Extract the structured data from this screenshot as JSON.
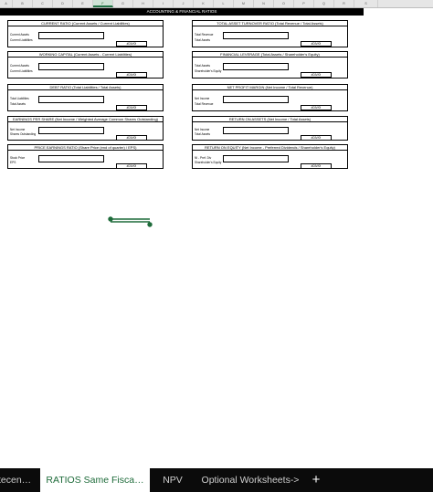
{
  "sheet": {
    "columns": [
      "A",
      "B",
      "C",
      "D",
      "E",
      "F",
      "G",
      "H",
      "I",
      "J",
      "K",
      "L",
      "M",
      "N",
      "O",
      "P",
      "Q",
      "R",
      "S"
    ],
    "selected_column": "F",
    "banner": "ACCOUNTING & FINANCIAL RATIOS"
  },
  "ratios": {
    "current_ratio": {
      "title": "CURRENT RATIO (Current Assets / Current Liabilities)",
      "labels": [
        "Current Assets",
        "Current Liabilities"
      ],
      "result": "#DIV/0!"
    },
    "asset_turnover": {
      "title": "TOTAL ASSET TURNOVER RATIO (Total Revenue / Total Assets)",
      "labels": [
        "Total Revenue",
        "Total Assets"
      ],
      "result": "#DIV/0!"
    },
    "working_capital": {
      "title": "WORKING CAPITAL (Current Assets - Current Liabilities)",
      "labels": [
        "Current Assets",
        "Current Liabilities"
      ],
      "result": "#DIV/0!"
    },
    "financial_leverage": {
      "title": "FINANCIAL LEVERAGE (Total Assets / Shareholder's Equity)",
      "labels": [
        "Total Assets",
        "Shareholder's Equity"
      ],
      "result": "#DIV/0!"
    },
    "debt_ratio": {
      "title": "DEBT RATIO (Total Liabilities / Total Assets)",
      "labels": [
        "Total Liabilities",
        "Total Assets"
      ],
      "result": "#DIV/0!"
    },
    "net_profit_margin": {
      "title": "NET PROFIT MARGIN (Net Income / Total Revenue)",
      "labels": [
        "Net Income",
        "Total Revenue"
      ],
      "result": "#DIV/0!"
    },
    "eps": {
      "title": "EARNINGS PER SHARE (Net Income / Weighted Average Common Shares Outstanding)",
      "labels": [
        "Net Income",
        "Shares Outstanding"
      ],
      "result": "#DIV/0!"
    },
    "roa": {
      "title": "RETURN ON ASSETS (Net Income / Total Assets)",
      "labels": [
        "Net Income",
        "Total Assets"
      ],
      "result": "#DIV/0!"
    },
    "pe_ratio": {
      "title": "PRICE EARNINGS RATIO (Share Price (end of quarter) / EPS)",
      "labels": [
        "Stock Price",
        "EPS"
      ],
      "result": "#DIV/0!"
    },
    "roe": {
      "title": "RETURN ON EQUITY (Net Income - Preferred Dividends / Shareholder's Equity)",
      "labels": [
        "NI - Pref. Div",
        "Shareholder's Equity"
      ],
      "result": "#DIV/0!"
    }
  },
  "tabs": {
    "t1": "tecen…",
    "t2": "RATIOS Same Fisca…",
    "t3": "NPV",
    "t4": "Optional Worksheets->",
    "add": "+"
  },
  "colors": {
    "accent": "#217346",
    "tab_active_text": "#1e6b3a",
    "shape": "#1e6b3a"
  }
}
